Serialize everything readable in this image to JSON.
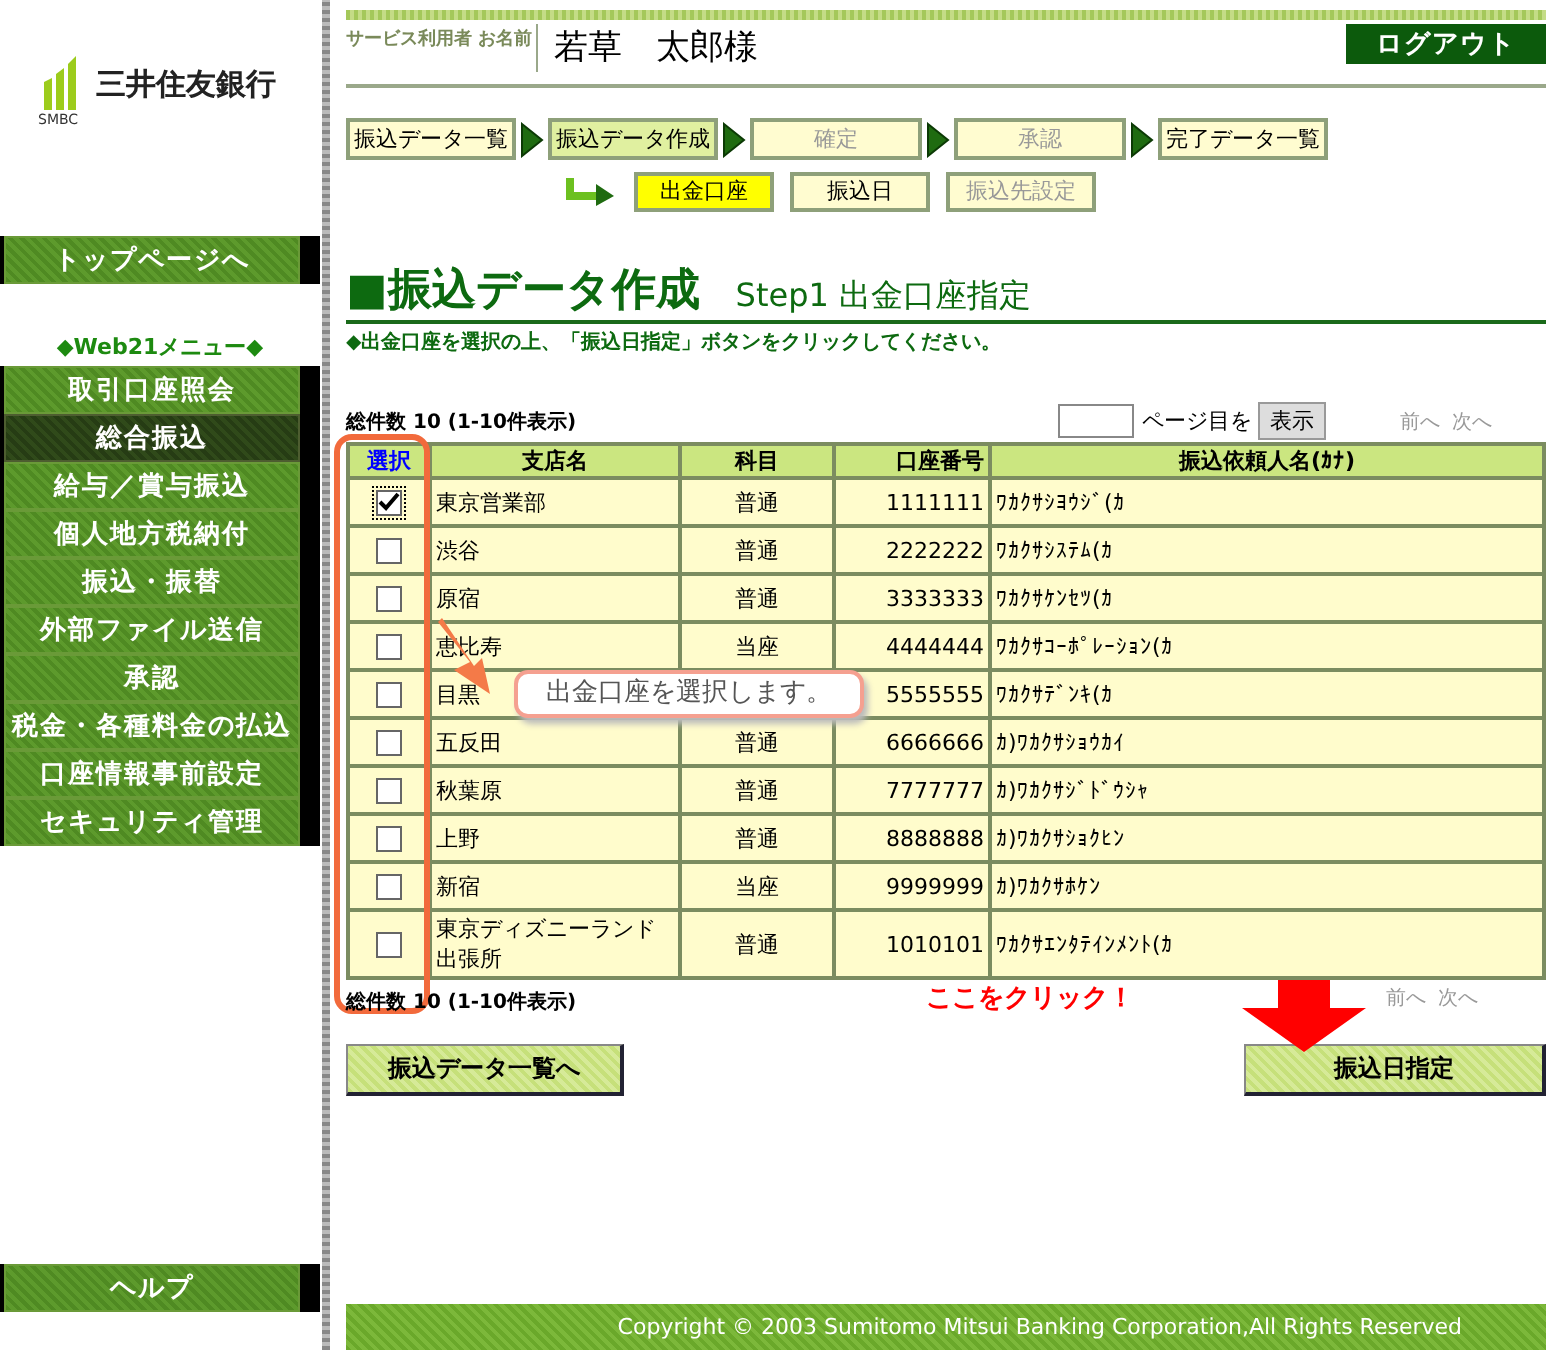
{
  "sidebar": {
    "logo": {
      "name": "三井住友銀行",
      "mark": "SMBC"
    },
    "top_button": "トップページへ",
    "menu_title": "◆Web21メニュー◆",
    "menu": [
      {
        "label": "取引口座照会",
        "selected": false
      },
      {
        "label": "総合振込",
        "selected": true
      },
      {
        "label": "給与／賞与振込",
        "selected": false
      },
      {
        "label": "個人地方税納付",
        "selected": false
      },
      {
        "label": "振込・振替",
        "selected": false
      },
      {
        "label": "外部ファイル送信",
        "selected": false
      },
      {
        "label": "承認",
        "selected": false
      },
      {
        "label": "税金・各種料金の払込",
        "selected": false
      },
      {
        "label": "口座情報事前設定",
        "selected": false
      },
      {
        "label": "セキュリティ管理",
        "selected": false
      }
    ],
    "help_button": "ヘルプ"
  },
  "header": {
    "user_label": "サービス利用者 お名前",
    "user_name": "若草　太郎様",
    "logout": "ログアウト"
  },
  "steps": [
    {
      "label": "振込データ一覧",
      "selected": false,
      "disabled": false
    },
    {
      "label": "振込データ作成",
      "selected": true,
      "disabled": false
    },
    {
      "label": "確定",
      "selected": false,
      "disabled": true
    },
    {
      "label": "承認",
      "selected": false,
      "disabled": true
    },
    {
      "label": "完了データ一覧",
      "selected": false,
      "disabled": false
    }
  ],
  "substeps": [
    {
      "label": "出金口座",
      "selected": true,
      "disabled": false
    },
    {
      "label": "振込日",
      "selected": false,
      "disabled": false
    },
    {
      "label": "振込先設定",
      "selected": false,
      "disabled": true
    }
  ],
  "title": "■振込データ作成",
  "subtitle": "Step1 出金口座指定",
  "instruction": "◆出金口座を選択の上、「振込日指定」ボタンをクリックしてください。",
  "count_top": "総件数 10 (1-10件表示)",
  "page_suffix": "ページ目を",
  "show_button": "表示",
  "pager_top": {
    "prev": "前へ",
    "next": "次へ"
  },
  "table": {
    "columns": [
      "選択",
      "支店名",
      "科目",
      "口座番号",
      "振込依頼人名(ｶﾅ)"
    ],
    "rows": [
      {
        "checked": true,
        "branch": "東京営業部",
        "type": "普通",
        "number": "1111111",
        "name": "ﾜｶｸｻｼﾖｳｼﾞ(ｶ"
      },
      {
        "checked": false,
        "branch": "渋谷",
        "type": "普通",
        "number": "2222222",
        "name": "ﾜｶｸｻｼｽﾃﾑ(ｶ"
      },
      {
        "checked": false,
        "branch": "原宿",
        "type": "普通",
        "number": "3333333",
        "name": "ﾜｶｸｻｹﾝｾﾂ(ｶ"
      },
      {
        "checked": false,
        "branch": "恵比寿",
        "type": "当座",
        "number": "4444444",
        "name": "ﾜｶｸｻｺｰﾎﾟﾚｰｼｮﾝ(ｶ"
      },
      {
        "checked": false,
        "branch": "目黒",
        "number": "5555555",
        "name": "ﾜｶｸｻﾃﾞﾝｷ(ｶ"
      },
      {
        "checked": false,
        "branch": "五反田",
        "type": "普通",
        "number": "6666666",
        "name": "ｶ)ﾜｶｸｻｼｮｳｶｲ"
      },
      {
        "checked": false,
        "branch": "秋葉原",
        "type": "普通",
        "number": "7777777",
        "name": "ｶ)ﾜｶｸｻｼﾞﾄﾞｳｼｬ"
      },
      {
        "checked": false,
        "branch": "上野",
        "type": "普通",
        "number": "8888888",
        "name": "ｶ)ﾜｶｸｻｼｮｸﾋﾝ"
      },
      {
        "checked": false,
        "branch": "新宿",
        "type": "当座",
        "number": "9999999",
        "name": "ｶ)ﾜｶｸｻﾎｹﾝ"
      },
      {
        "checked": false,
        "branch": "東京ディズニーランド出張所",
        "type": "普通",
        "number": "1010101",
        "name": "ﾜｶｸｻｴﾝﾀﾃｲﾝﾒﾝﾄ(ｶ"
      }
    ]
  },
  "callout": "出金口座を選択します。",
  "count_bottom": "総件数 10 (1-10件表示)",
  "click_hint": "ここをクリック！",
  "pager_bottom": {
    "prev": "前へ",
    "next": "次へ"
  },
  "back_button": "振込データ一覧へ",
  "next_button": "振込日指定",
  "footer": "Copyright © 2003 Sumitomo Mitsui Banking Corporation,All Rights Reserved"
}
